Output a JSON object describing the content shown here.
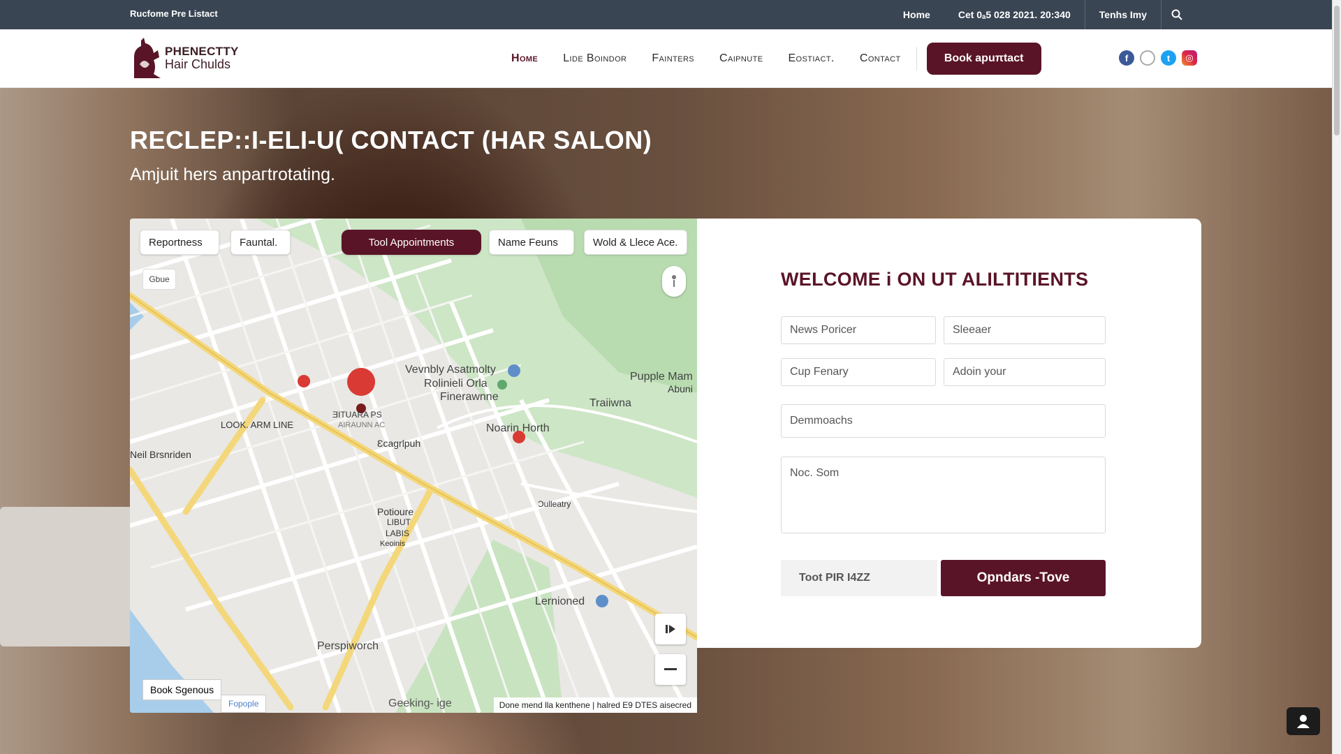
{
  "topbar": {
    "left_text": "Rucfome Pre Listact",
    "home": "Home",
    "date": "Cet 0ₐ5 028 2021. 20:340",
    "terms": "Tenhs Imy"
  },
  "header": {
    "logo_line1": "PHENECTTY",
    "logo_line2": "Hair Chulds",
    "nav": [
      "Home",
      "Lide Boindor",
      "Fainters",
      "Caipnute",
      "Eostiact.",
      "Contact"
    ],
    "book_button": "Book apuπtact"
  },
  "hero": {
    "title": "RECLEP::I-ELI-U( CONTACT (HAR SALON)",
    "subtitle": "Amjuit hers anpaгtrotating."
  },
  "map": {
    "chips": [
      "Reportness",
      "Fauntal.",
      "Tool Appointments",
      "Name Feuns",
      "Wold & Llece Ace."
    ],
    "small_button": "Gbue",
    "labels": {
      "venue1": "Vevnbly Asatmolty",
      "venue2": "Rolinieli Orla",
      "venue3": "Finerawnne",
      "puppie1": "Pupple Mam",
      "puppie2": "Abuni",
      "trail": "Traiiwna",
      "north": "Noarin Horth",
      "look": "LOOK. ARM LINE",
      "neil": "Neil Brsnriden",
      "scroll": "Ɛcagrlpuh",
      "ticus1": "ƎITUARA PS",
      "ticus2": "AIRAUNN AC",
      "potiure1": "Potioure",
      "potiure2": "LIBUT",
      "potiure3": "LABIS",
      "potiure4": "Keoinis",
      "collaboy": "Ɔulleatry",
      "lernioned": "Lernioned",
      "perspiworch": "Perspiworch",
      "geeking": "Geeking- ige"
    },
    "book_signs": "Book Sgenous",
    "feedback": "Fopople",
    "attribution": "Done mend lla kenthene | halred E9 DTES aisecred"
  },
  "form": {
    "title": "WELCOME i ON UT ALILTITIENTS",
    "fields": {
      "f1": "News Poricer",
      "f2": "Sleeaer",
      "f3": "Cup Fenary",
      "f4": "Adoin your",
      "f5": "Demmoachs",
      "f6": "Noc. Som"
    },
    "captcha": "Toot PIR I4ZZ",
    "submit": "Opndars -Tove"
  },
  "colors": {
    "brand": "#5a1427",
    "topbar": "#3a4553"
  }
}
